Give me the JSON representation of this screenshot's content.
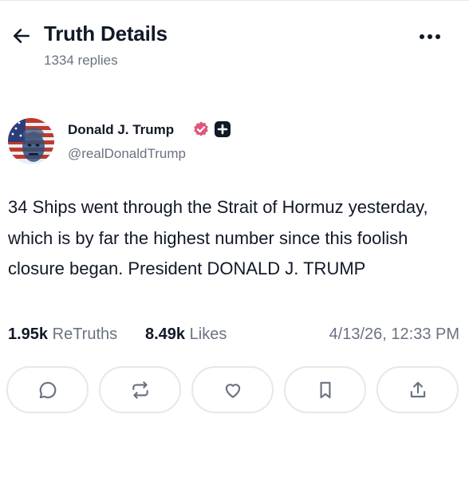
{
  "header": {
    "title": "Truth Details",
    "reply_count": "1334 replies"
  },
  "author": {
    "display_name": "Donald J. Trump",
    "handle": "@realDonaldTrump",
    "verified_color": "#e0567f"
  },
  "post": {
    "text": "34 Ships went through the Strait of Hormuz yesterday, which is by far the highest number since this foolish closure began. President DONALD J. TRUMP"
  },
  "stats": {
    "retruths_count": "1.95k",
    "retruths_label": "ReTruths",
    "likes_count": "8.49k",
    "likes_label": "Likes",
    "timestamp": "4/13/26, 12:33 PM"
  },
  "actions": [
    {
      "icon": "reply-icon"
    },
    {
      "icon": "retruth-icon"
    },
    {
      "icon": "heart-icon"
    },
    {
      "icon": "bookmark-icon"
    },
    {
      "icon": "share-icon"
    }
  ]
}
